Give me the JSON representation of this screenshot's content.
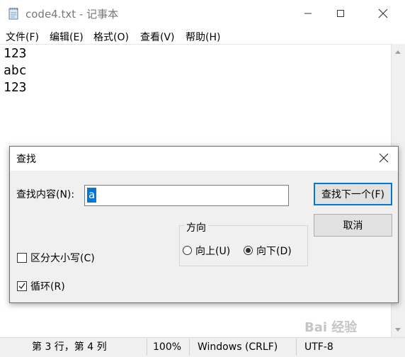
{
  "window": {
    "title": "code4.txt - 记事本"
  },
  "menu": [
    "文件(F)",
    "编辑(E)",
    "格式(O)",
    "查看(V)",
    "帮助(H)"
  ],
  "editor": {
    "lines": [
      "123",
      "abc",
      "123"
    ]
  },
  "statusbar": {
    "position": "第 3 行，第 4 列",
    "zoom": "100%",
    "line_ending": "Windows (CRLF)",
    "encoding": "UTF-8"
  },
  "find_dialog": {
    "title": "查找",
    "find_label": "查找内容(N):",
    "find_value": "a",
    "find_next_label": "查找下一个(F)",
    "cancel_label": "取消",
    "direction_title": "方向",
    "direction_up": "向上(U)",
    "direction_down": "向下(D)",
    "direction_selected": "down",
    "match_case_label": "区分大小写(C)",
    "match_case": false,
    "wrap_label": "循环(R)",
    "wrap": true
  },
  "watermark": "Bai 经验",
  "icons": {
    "app": "notepad-icon",
    "minimize": "minimize-icon",
    "maximize": "maximize-icon",
    "close": "close-icon"
  }
}
